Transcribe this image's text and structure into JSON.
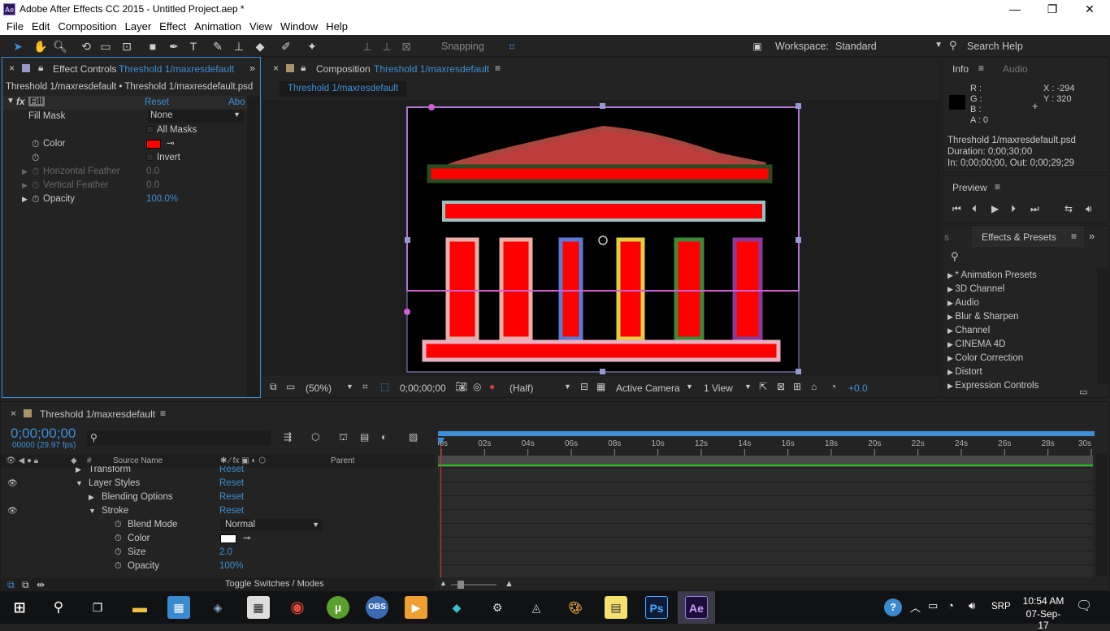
{
  "window": {
    "title": "Adobe After Effects CC 2015 - Untitled Project.aep *",
    "app_icon": "Ae",
    "minimize": "—",
    "maximize": "❐",
    "close": "✕"
  },
  "menu": [
    "File",
    "Edit",
    "Composition",
    "Layer",
    "Effect",
    "Animation",
    "View",
    "Window",
    "Help"
  ],
  "toolbar": {
    "snapping_label": "Snapping",
    "workspace_label": "Workspace:",
    "workspace_value": "Standard",
    "search_help": "Search Help"
  },
  "effect_controls": {
    "tab_label": "Effect Controls",
    "tab_layer": "Threshold 1/maxresdefault",
    "breadcrumb": "Threshold 1/maxresdefault • Threshold 1/maxresdefault.psd",
    "effect_name": "Fill",
    "reset": "Reset",
    "about": "Abo",
    "fill_mask_label": "Fill Mask",
    "fill_mask_value": "None",
    "all_masks": "All Masks",
    "color_label": "Color",
    "fill_color": "#ff0000",
    "invert": "Invert",
    "h_feather_label": "Horizontal Feather",
    "h_feather_value": "0.0",
    "v_feather_label": "Vertical Feather",
    "v_feather_value": "0.0",
    "opacity_label": "Opacity",
    "opacity_value": "100.0%"
  },
  "composition": {
    "tab_label": "Composition",
    "tab_name": "Threshold 1/maxresdefault",
    "subtab": "Threshold 1/maxresdefault",
    "zoom": "(50%)",
    "timecode": "0;00;00;00",
    "resolution": "(Half)",
    "camera": "Active Camera",
    "view": "1 View",
    "exposure": "+0.0"
  },
  "info": {
    "tab_info": "Info",
    "tab_audio": "Audio",
    "r": "R :",
    "g": "G :",
    "b": "B :",
    "a": "A :  0",
    "x": "X : -294",
    "y": "Y : 320",
    "file": "Threshold 1/maxresdefault.psd",
    "duration": "Duration: 0;00;30;00",
    "inout": "In: 0;00;00;00, Out: 0;00;29;29"
  },
  "preview": {
    "label": "Preview"
  },
  "effects_presets": {
    "tab_label": "Effects & Presets",
    "tab_s": "s",
    "items": [
      "* Animation Presets",
      "3D Channel",
      "Audio",
      "Blur & Sharpen",
      "Channel",
      "CINEMA 4D",
      "Color Correction",
      "Distort",
      "Expression Controls"
    ]
  },
  "timeline": {
    "tab_name": "Threshold 1/maxresdefault",
    "timecode": "0;00;00;00",
    "fps": "00000 (29.97 fps)",
    "col_hash": "#",
    "col_source": "Source Name",
    "col_parent": "Parent",
    "ruler": [
      "00s",
      "02s",
      "04s",
      "06s",
      "08s",
      "10s",
      "12s",
      "14s",
      "16s",
      "18s",
      "20s",
      "22s",
      "24s",
      "26s",
      "28s",
      "30s"
    ],
    "rows": [
      {
        "label": "Transform",
        "value": "Reset"
      },
      {
        "label": "Layer Styles",
        "value": "Reset"
      },
      {
        "label": "Blending Options",
        "value": "Reset"
      },
      {
        "label": "Stroke",
        "value": "Reset"
      },
      {
        "label": "Blend Mode",
        "value": "Normal"
      },
      {
        "label": "Color",
        "value": ""
      },
      {
        "label": "Size",
        "value": "2.0"
      },
      {
        "label": "Opacity",
        "value": "100%"
      }
    ],
    "toggle": "Toggle Switches / Modes"
  },
  "taskbar": {
    "time": "10:54 AM",
    "date": "07-Sep-17",
    "lang": "SRP",
    "ps": "Ps",
    "ae": "Ae"
  }
}
